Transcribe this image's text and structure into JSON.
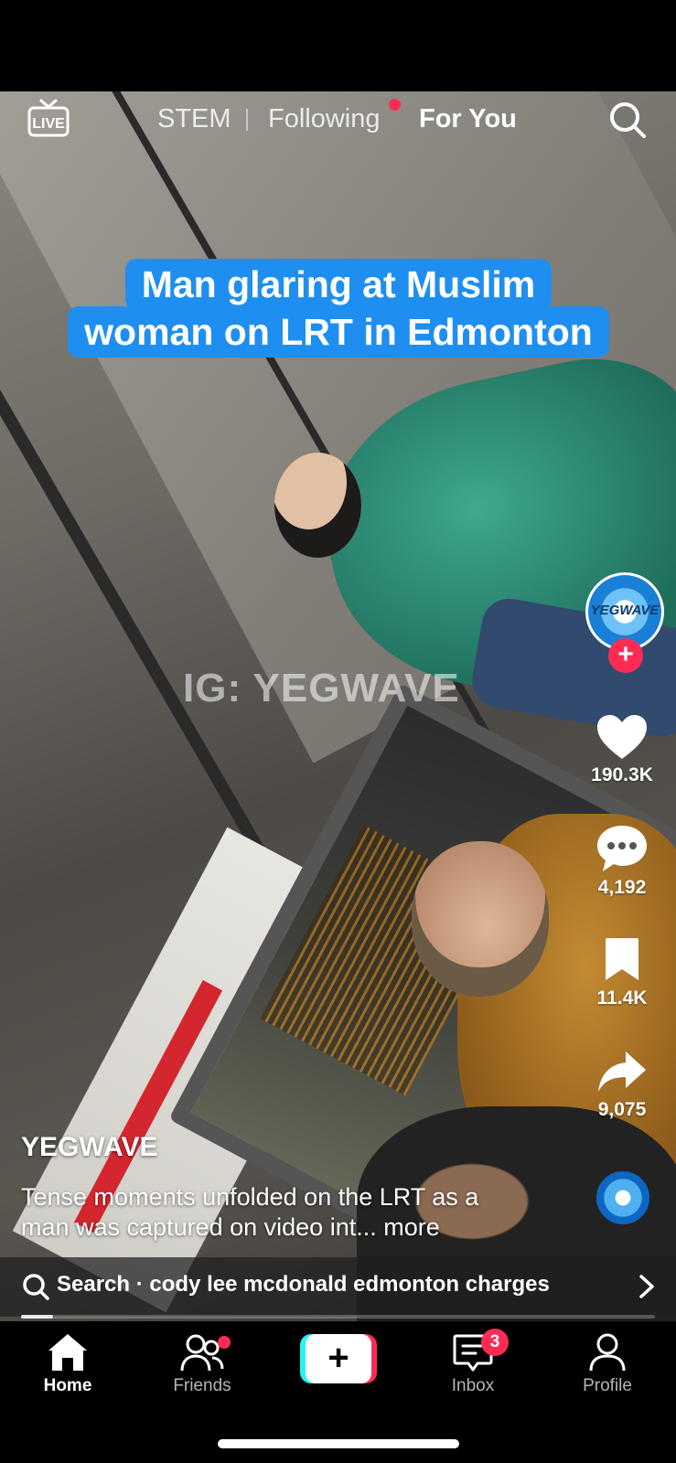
{
  "top_nav": {
    "live_label": "LIVE",
    "tabs": [
      {
        "label": "STEM",
        "active": false
      },
      {
        "label": "Following",
        "active": false,
        "has_dot": true
      },
      {
        "label": "For You",
        "active": true
      }
    ]
  },
  "video": {
    "caption_line1": "Man glaring at Muslim",
    "caption_line2": "woman on LRT in Edmonton",
    "watermark": "IG: YEGWAVE",
    "progress_fraction": 0.05
  },
  "creator": {
    "avatar_text": "YEGWAVE",
    "name": "YEGWAVE",
    "description": "Tense moments unfolded on the LRT as a man was captured on video int...",
    "more_label": " more"
  },
  "actions": {
    "likes": "190.3K",
    "comments": "4,192",
    "saves": "11.4K",
    "shares": "9,075"
  },
  "search_bar": {
    "text": "Search · cody lee mcdonald edmonton charges"
  },
  "tab_bar": {
    "home": "Home",
    "friends": "Friends",
    "create": "+",
    "inbox": "Inbox",
    "inbox_badge": "3",
    "profile": "Profile"
  },
  "colors": {
    "accent_red": "#fe2c55",
    "accent_cyan": "#25f4ee",
    "caption_blue": "#1e8ff0"
  }
}
